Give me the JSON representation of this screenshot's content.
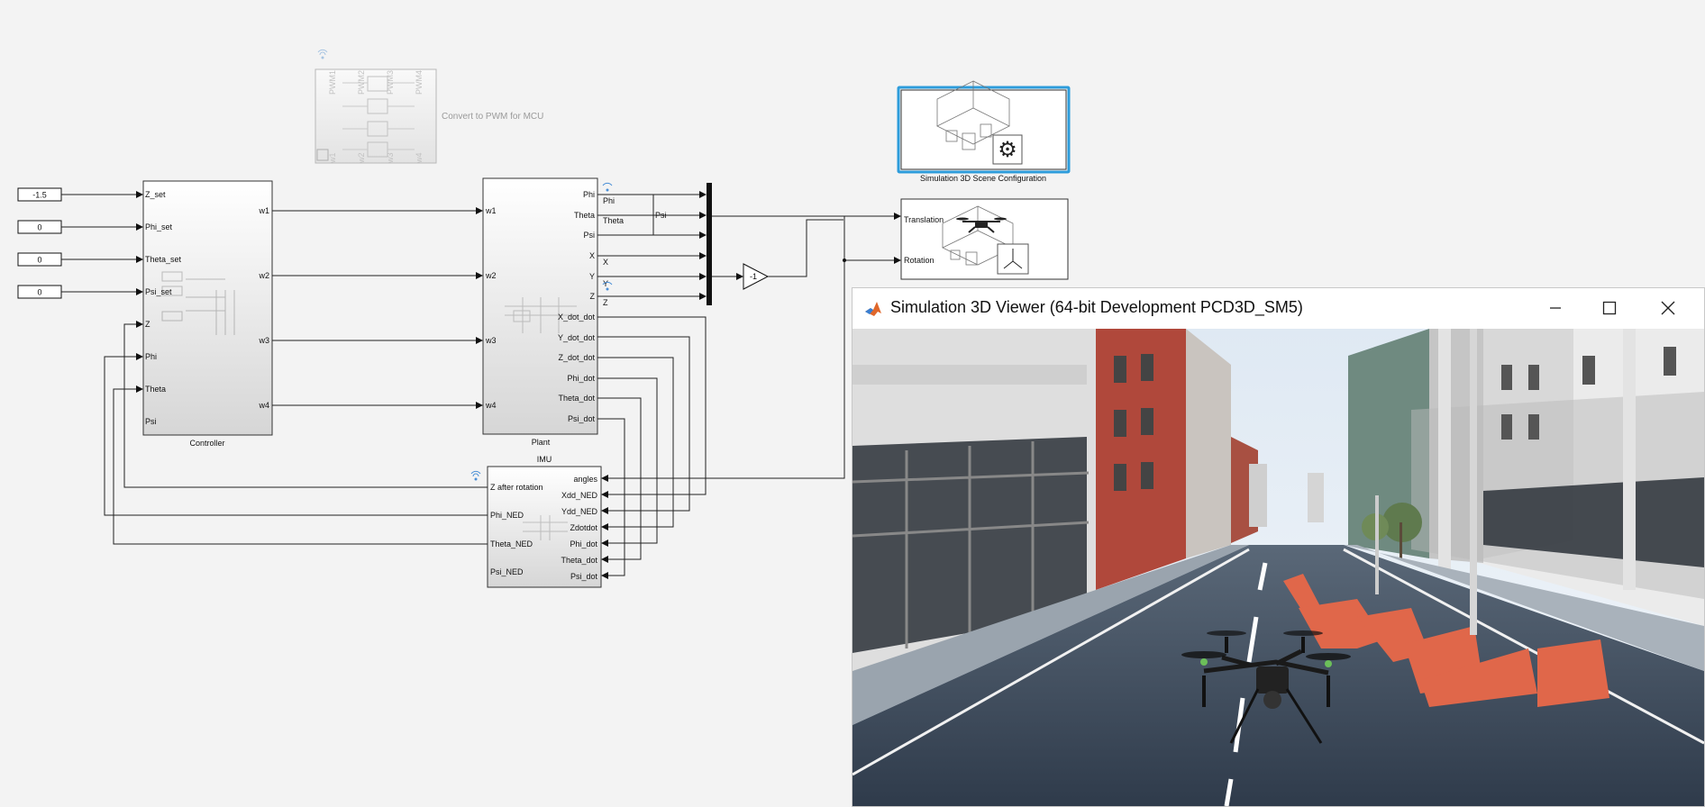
{
  "constants": [
    {
      "value": "-1.5"
    },
    {
      "value": "0"
    },
    {
      "value": "0"
    },
    {
      "value": "0"
    }
  ],
  "pwm_block": {
    "caption": "Convert to PWM for MCU",
    "ports_top": [
      "PWM1",
      "PWM2",
      "PWM3",
      "PWM4"
    ],
    "ports_bottom": [
      "w1",
      "w2",
      "w3",
      "w4"
    ]
  },
  "controller": {
    "name": "Controller",
    "inputs": [
      "Z_set",
      "Phi_set",
      "Theta_set",
      "Psi_set",
      "Z",
      "Phi",
      "Theta",
      "Psi"
    ],
    "outputs": [
      "w1",
      "w2",
      "w3",
      "w4"
    ]
  },
  "plant": {
    "name": "Plant",
    "inputs": [
      "w1",
      "w2",
      "w3",
      "w4"
    ],
    "outputs": [
      "Phi",
      "Theta",
      "Psi",
      "X",
      "Y",
      "Z",
      "X_dot_dot",
      "Y_dot_dot",
      "Z_dot_dot",
      "Phi_dot",
      "Theta_dot",
      "Psi_dot"
    ],
    "signal_labels": [
      "Phi",
      "Theta",
      "Psi",
      "X",
      "Y",
      "Z"
    ]
  },
  "imu": {
    "name": "IMU",
    "inputs": [
      "angles",
      "Xdd_NED",
      "Ydd_NED",
      "Zdotdot",
      "Phi_dot",
      "Theta_dot",
      "Psi_dot"
    ],
    "outputs": [
      "Z after rotation",
      "Phi_NED",
      "Theta_NED",
      "Psi_NED"
    ]
  },
  "gain": {
    "value": "-1"
  },
  "scene_config": {
    "caption": "Simulation 3D Scene Configuration"
  },
  "uav_block": {
    "inputs": [
      "Translation",
      "Rotation"
    ]
  },
  "viewer": {
    "title": "Simulation 3D Viewer (64-bit Development PCD3D_SM5)",
    "buttons": [
      "minimize",
      "maximize",
      "close"
    ]
  },
  "colors": {
    "canvas": "#f3f3f3",
    "selection": "#2d9cdb",
    "road": "#3c4a5c",
    "barrier": "#e0674a",
    "sky": "#e9f1f8"
  }
}
